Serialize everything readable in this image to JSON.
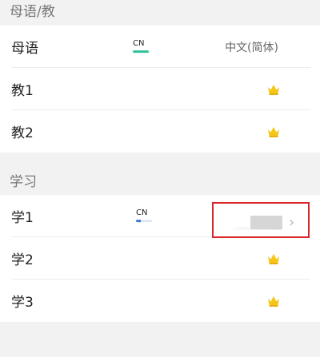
{
  "native_section": {
    "title": "母语/教",
    "rows": [
      {
        "label": "母语",
        "code": "CN",
        "value": "中文(简体)"
      },
      {
        "label": "教1"
      },
      {
        "label": "教2"
      }
    ]
  },
  "learn_section": {
    "title": "学习",
    "rows": [
      {
        "label": "学1",
        "code": "CN"
      },
      {
        "label": "学2"
      },
      {
        "label": "学3"
      }
    ]
  },
  "icons": {
    "crown": "crown-icon",
    "chevron": "chevron-right-icon"
  },
  "colors": {
    "crown": "#f5c518",
    "native_underline": "#2fc29a",
    "learn_underline": "#3a7bd5",
    "highlight_border": "#d9262a"
  }
}
